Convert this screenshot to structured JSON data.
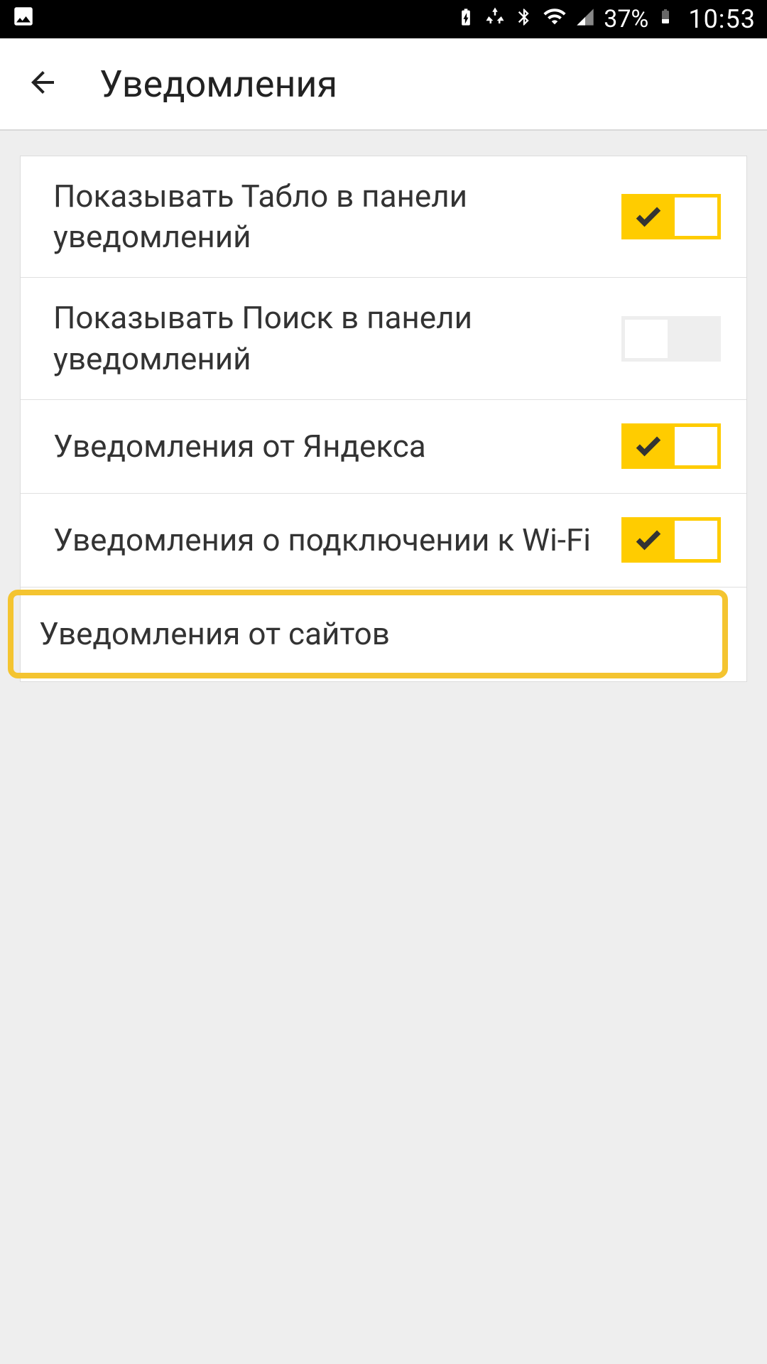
{
  "status": {
    "battery_percent": "37%",
    "time": "10:53"
  },
  "header": {
    "title": "Уведомления"
  },
  "settings": {
    "items": [
      {
        "label": "Показывать Табло в панели уведомлений",
        "toggle": "on"
      },
      {
        "label": "Показывать Поиск в панели уведомлений",
        "toggle": "off"
      },
      {
        "label": "Уведомления от Яндекса",
        "toggle": "on"
      },
      {
        "label": "Уведомления о подключении к Wi-Fi",
        "toggle": "on"
      },
      {
        "label": "Уведомления от сайтов",
        "toggle": null,
        "highlighted": true
      }
    ]
  }
}
